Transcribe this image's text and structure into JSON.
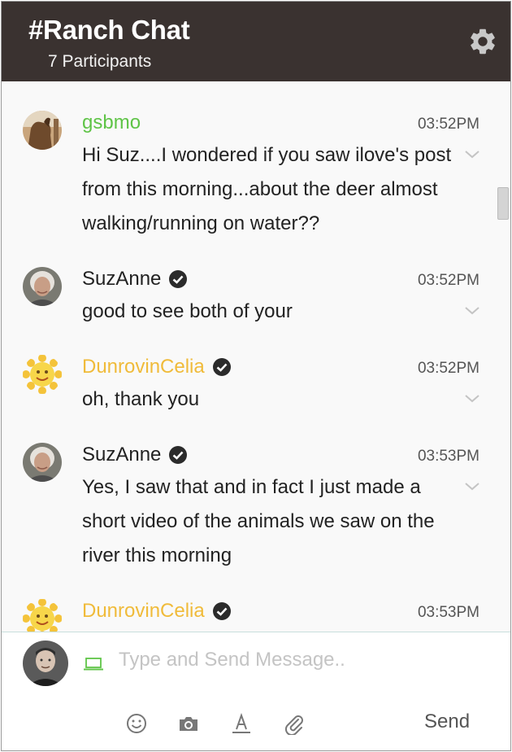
{
  "header": {
    "title": "#Ranch Chat",
    "participants": "7 Participants"
  },
  "messages": [
    {
      "user": "gsbmo",
      "name_color": "#5fc447",
      "verified": false,
      "avatar": "horse-photo-avatar",
      "time": "03:52PM",
      "text": "Hi Suz....I wondered if you saw ilove's post from this morning...about the deer almost walking/running on water??"
    },
    {
      "user": "SuzAnne",
      "name_color": "#222222",
      "verified": true,
      "avatar": "woman-photo-avatar",
      "time": "03:52PM",
      "text": "good to see both of your"
    },
    {
      "user": "DunrovinCelia",
      "name_color": "#f0bb3a",
      "verified": true,
      "avatar": "sun-avatar",
      "time": "03:52PM",
      "text": "oh, thank you"
    },
    {
      "user": "SuzAnne",
      "name_color": "#222222",
      "verified": true,
      "avatar": "woman-photo-avatar",
      "time": "03:53PM",
      "text": "Yes, I saw that and in fact I just made a short video of the animals we saw on the river this morning"
    },
    {
      "user": "DunrovinCelia",
      "name_color": "#f0bb3a",
      "verified": true,
      "avatar": "sun-avatar",
      "time": "03:53PM",
      "text": ""
    }
  ],
  "composer": {
    "placeholder": "Type and Send Message..",
    "send_label": "Send",
    "tools": [
      "emoji-icon",
      "camera-icon",
      "text-format-icon",
      "attachment-icon"
    ]
  },
  "colors": {
    "header_bg": "#3a3230",
    "accent_green": "#5fc447",
    "accent_yellow": "#f0bb3a"
  }
}
